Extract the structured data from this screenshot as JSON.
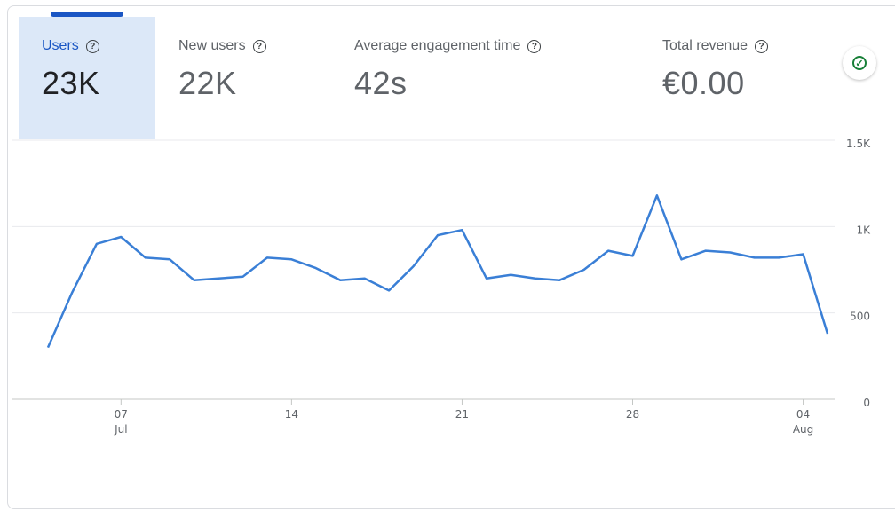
{
  "metrics": [
    {
      "label": "Users",
      "value": "23K"
    },
    {
      "label": "New users",
      "value": "22K"
    },
    {
      "label": "Average engagement time",
      "value": "42s"
    },
    {
      "label": "Total revenue",
      "value": "€0.00"
    }
  ],
  "help_icon": "help-circle-icon",
  "status_icon": "check-circle-icon",
  "colors": {
    "accent": "#1a56c4",
    "line": "#3a7fd6",
    "active_tab_bg": "#dce8f8",
    "status": "#188038"
  },
  "chart_data": {
    "type": "line",
    "x_tick_labels": [
      {
        "day": "07",
        "month": "Jul"
      },
      {
        "day": "14",
        "month": ""
      },
      {
        "day": "21",
        "month": ""
      },
      {
        "day": "28",
        "month": ""
      },
      {
        "day": "04",
        "month": "Aug"
      }
    ],
    "y_tick_labels": [
      "0",
      "500",
      "1K",
      "1.5K"
    ],
    "ylim": [
      0,
      1500
    ],
    "grid": true,
    "series": [
      {
        "values": [
          300,
          620,
          900,
          940,
          820,
          810,
          690,
          700,
          710,
          820,
          810,
          760,
          690,
          700,
          630,
          770,
          950,
          980,
          700,
          720,
          700,
          690,
          750,
          860,
          830,
          1180,
          810,
          860,
          850,
          820,
          820,
          840,
          380
        ]
      }
    ]
  }
}
